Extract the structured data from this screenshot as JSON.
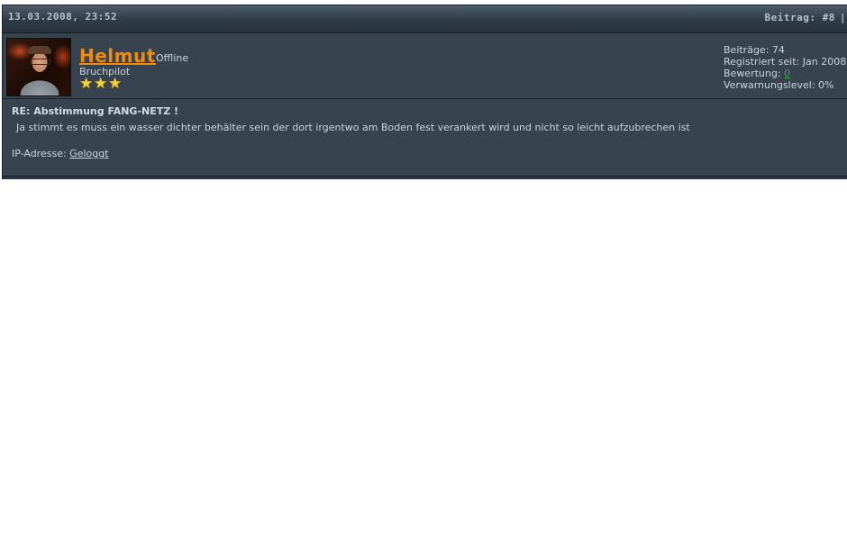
{
  "post": {
    "date": "13.03.2008, 23:52",
    "number_label": "Beitrag: #8",
    "separator": "|"
  },
  "author": {
    "name": "Helmut",
    "status": "Offline",
    "rank": "Bruchpilot",
    "stars": 3,
    "star_glyph": "★",
    "avatar_icon": "user-avatar-photo"
  },
  "stats": {
    "posts_label": "Beiträge:",
    "posts_value": "74",
    "registered_label": "Registriert seit:",
    "registered_value": "Jan 2008",
    "rating_label": "Bewertung:",
    "rating_value": "0",
    "warning_label": "Verwarnungslevel:",
    "warning_value": "0%"
  },
  "message": {
    "subject": "RE: Abstimmung FANG-NETZ !",
    "text": "Ja stimmt es muss ein wasser dichter behälter sein der dort irgentwo am Boden fest verankert wird und nicht so leicht aufzubrechen ist",
    "ip_label": "IP-Adresse:",
    "ip_value": "Geloggt"
  },
  "colors": {
    "username": "#ef8b12",
    "panel_bg": "#37444f",
    "text": "#c9d3dc",
    "rating": "#3aa14a",
    "star": "#f7cf3a"
  }
}
